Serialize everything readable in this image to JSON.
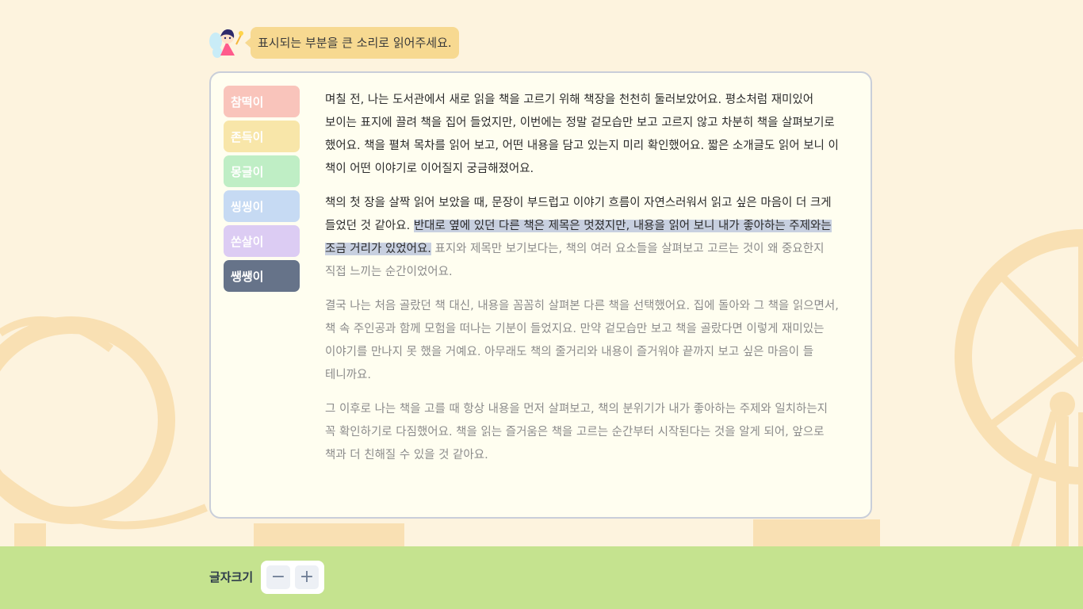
{
  "instruction": {
    "text": "표시되는 부분을 큰 소리로 읽어주세요.",
    "icon": "fairy-icon"
  },
  "voices": [
    {
      "label": "참떡이",
      "color": "#f9c4bb"
    },
    {
      "label": "존득이",
      "color": "#f8e6a9"
    },
    {
      "label": "몽글이",
      "color": "#bfeec5"
    },
    {
      "label": "씽씽이",
      "color": "#c6daf3"
    },
    {
      "label": "쏜살이",
      "color": "#dcccf3"
    },
    {
      "label": "쌩쌩이",
      "color": "#667389"
    }
  ],
  "passage": {
    "p1": "며칠 전, 나는 도서관에서 새로 읽을 책을 고르기 위해 책장을 천천히 둘러보았어요. 평소처럼 재미있어 보이는 표지에 끌려 책을 집어 들었지만, 이번에는 정말 겉모습만 보고 고르지 않고 차분히 책을 살펴보기로 했어요. 책을 펼쳐 목차를 읽어 보고, 어떤 내용을 담고 있는지 미리 확인했어요. 짧은 소개글도 읽어 보니 이 책이 어떤 이야기로 이어질지 궁금해졌어요.",
    "p2_before": "책의 첫 장을 살짝 읽어 보았을 때, 문장이 부드럽고 이야기 흐름이 자연스러워서 읽고 싶은 마음이 더 크게 들었던 것 같아요.",
    "p2_highlight": "반대로 옆에 있던 다른 책은 제목은 멋졌지만, 내용을 읽어 보니 내가 좋아하는 주제와는 조금 거리가 있었어요.",
    "p2_after": "표지와 제목만 보기보다는, 책의 여러 요소들을 살펴보고 고르는 것이 왜 중요한지 직접 느끼는 순간이었어요.",
    "p3": "결국 나는 처음 골랐던 책 대신, 내용을 꼼꼼히 살펴본 다른 책을 선택했어요. 집에 돌아와 그 책을 읽으면서, 책 속 주인공과 함께 모험을 떠나는 기분이 들었지요. 만약 겉모습만 보고 책을 골랐다면 이렇게 재미있는 이야기를 만나지 못 했을 거예요. 아무래도 책의 줄거리와 내용이 즐거워야 끝까지 보고 싶은 마음이 들 테니까요.",
    "p4": "그 이후로 나는 책을 고를 때 항상 내용을 먼저 살펴보고, 책의 분위기가 내가 좋아하는 주제와 일치하는지 꼭 확인하기로 다짐했어요. 책을 읽는 즐거움은 책을 고르는 순간부터 시작된다는 것을 알게 되어, 앞으로 책과 더 친해질 수 있을 것 같아요."
  },
  "footer": {
    "font_size_label": "글자크기",
    "minus": "−",
    "plus": "+"
  }
}
